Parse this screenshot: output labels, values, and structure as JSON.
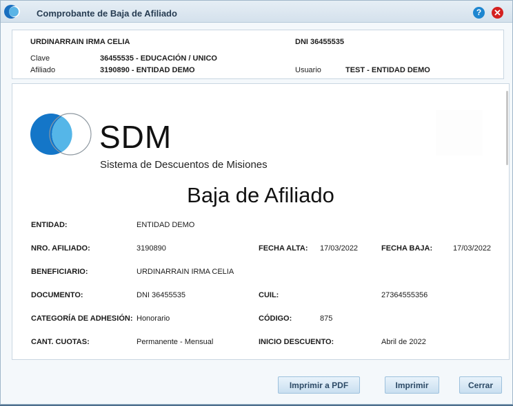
{
  "window": {
    "title": "Comprobante de Baja de Afiliado",
    "help_label": "?",
    "close_label": "✕",
    "accent": "#1e86d0",
    "close_color": "#d42020"
  },
  "header": {
    "name": "URDINARRAIN IRMA CELIA",
    "dni": "DNI  36455535",
    "clave_label": "Clave",
    "clave_value": "36455535  -  EDUCACIÓN / UNICO",
    "afiliado_label": "Afiliado",
    "afiliado_value": "3190890  -  ENTIDAD DEMO",
    "usuario_label": "Usuario",
    "usuario_value": "TEST  -  ENTIDAD DEMO"
  },
  "document": {
    "brand": "SDM",
    "brand_subtitle": "Sistema de Descuentos de Misiones",
    "title": "Baja de Afiliado",
    "fields": {
      "entidad": {
        "label": "ENTIDAD:",
        "value": "ENTIDAD DEMO"
      },
      "nro_afiliado": {
        "label": "NRO. AFILIADO:",
        "value": "3190890"
      },
      "fecha_alta": {
        "label": "FECHA ALTA:",
        "value": "17/03/2022"
      },
      "fecha_baja": {
        "label": "FECHA BAJA:",
        "value": "17/03/2022"
      },
      "beneficiario": {
        "label": "BENEFICIARIO:",
        "value": "URDINARRAIN IRMA CELIA"
      },
      "documento": {
        "label": "DOCUMENTO:",
        "value": "DNI 36455535"
      },
      "cuil": {
        "label": "CUIL:",
        "value": "27364555356"
      },
      "categoria": {
        "label": "CATEGORÍA DE ADHESIÓN:",
        "value": "Honorario"
      },
      "codigo": {
        "label": "CÓDIGO:",
        "value": "875"
      },
      "cant_cuotas": {
        "label": "CANT. CUOTAS:",
        "value": "Permanente - Mensual"
      },
      "inicio_descuento": {
        "label": "INICIO DESCUENTO:",
        "value": "Abril de 2022"
      }
    }
  },
  "buttons": {
    "print_pdf": "Imprimir a PDF",
    "print": "Imprimir",
    "close": "Cerrar"
  }
}
